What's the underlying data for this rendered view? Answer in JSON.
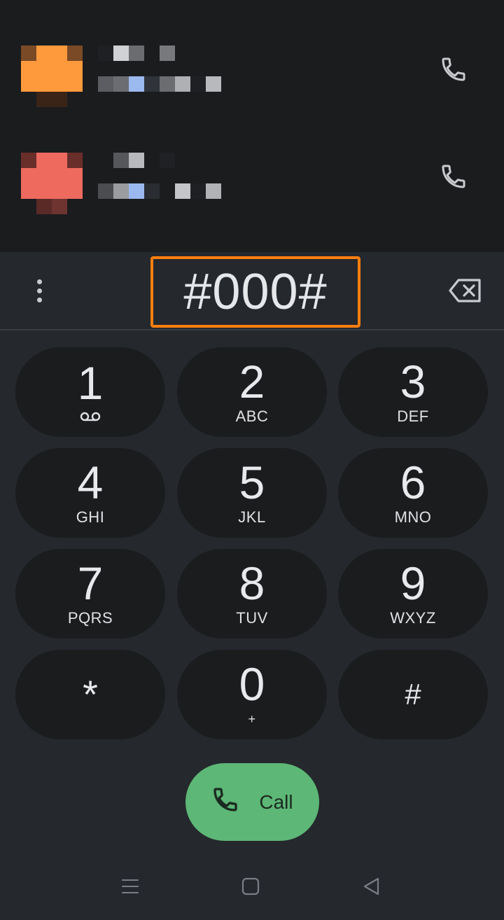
{
  "contacts": [
    {
      "avatar_color": "#ff9a3c",
      "avatar_shadow": "#a35a1e",
      "action_icon": "phone-icon"
    },
    {
      "avatar_color": "#ee6a5f",
      "avatar_shadow": "#8a3a34",
      "action_icon": "phone-icon"
    }
  ],
  "dialer": {
    "entered_digits": "#000#",
    "menu_icon": "more-vert-icon",
    "backspace_icon": "backspace-icon",
    "highlight_color": "#ff7f0e"
  },
  "keypad": {
    "keys": [
      {
        "digit": "1",
        "letters": "",
        "icon": "voicemail-icon"
      },
      {
        "digit": "2",
        "letters": "ABC"
      },
      {
        "digit": "3",
        "letters": "DEF"
      },
      {
        "digit": "4",
        "letters": "GHI"
      },
      {
        "digit": "5",
        "letters": "JKL"
      },
      {
        "digit": "6",
        "letters": "MNO"
      },
      {
        "digit": "7",
        "letters": "PQRS"
      },
      {
        "digit": "8",
        "letters": "TUV"
      },
      {
        "digit": "9",
        "letters": "WXYZ"
      },
      {
        "digit": "*",
        "letters": ""
      },
      {
        "digit": "0",
        "letters": "+"
      },
      {
        "digit": "#",
        "letters": ""
      }
    ]
  },
  "call_button": {
    "label": "Call",
    "icon": "phone-icon",
    "color": "#5db776"
  },
  "navbar": {
    "items": [
      "menu-icon",
      "home-icon",
      "back-icon"
    ]
  }
}
